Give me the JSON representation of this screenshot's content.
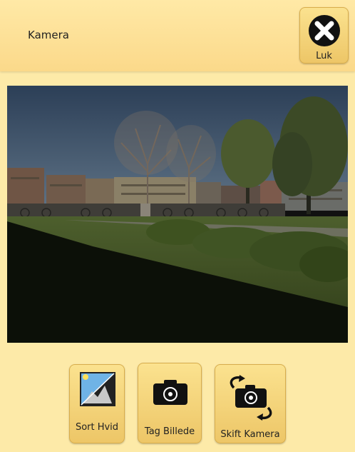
{
  "header": {
    "title": "Kamera",
    "close_label": "Luk"
  },
  "preview": {
    "alt": "camera preview"
  },
  "controls": {
    "bw_label": "Sort Hvid",
    "capture_label": "Tag Billede",
    "switch_label": "Skift Kamera"
  },
  "icons": {
    "close": "close-x-icon",
    "bw": "black-white-image-icon",
    "capture": "camera-icon",
    "switch": "switch-camera-icon"
  }
}
